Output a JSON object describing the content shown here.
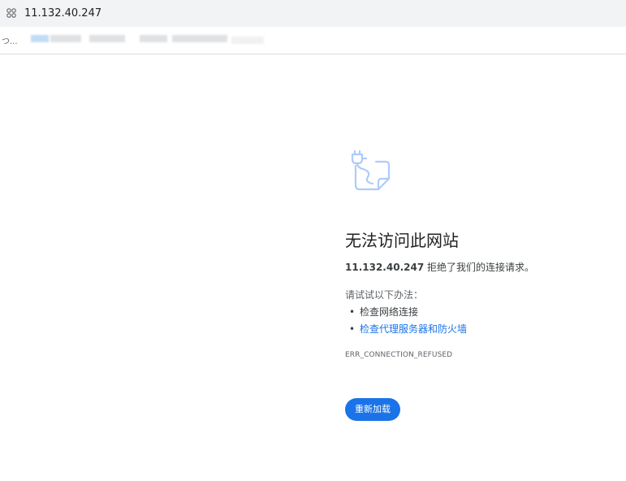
{
  "browser": {
    "url": "11.132.40.247",
    "site_info_icon": "site-settings-icon",
    "bookmarks_overflow": "つ..."
  },
  "error_page": {
    "icon": "disconnected-plug-icon",
    "heading": "无法访问此网站",
    "host": "11.132.40.247",
    "description_suffix": " 拒绝了我们的连接请求。",
    "suggestions_title": "请试试以下办法：",
    "suggestions": [
      "检查网络连接",
      "检查代理服务器和防火墙"
    ],
    "error_code": "ERR_CONNECTION_REFUSED",
    "reload_label": "重新加载"
  },
  "colors": {
    "accent": "#1a73e8",
    "icon_stroke": "#aecbfa",
    "toolbar_bg": "#f1f3f4"
  }
}
